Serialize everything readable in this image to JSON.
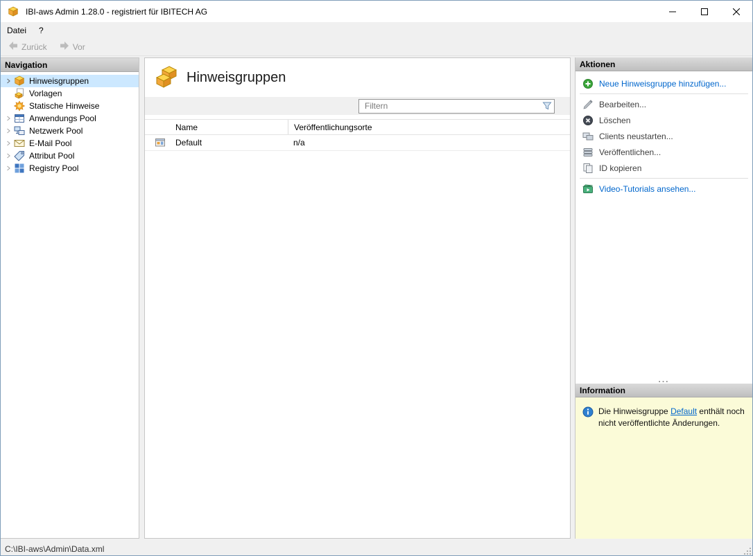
{
  "window": {
    "title": "IBI-aws Admin 1.28.0 - registriert für IBITECH AG"
  },
  "menu": {
    "file": "Datei",
    "help": "?"
  },
  "toolbar": {
    "back": "Zurück",
    "forward": "Vor"
  },
  "navigation": {
    "header": "Navigation",
    "items": [
      {
        "label": "Hinweisgruppen",
        "icon": "hint-group-icon",
        "expandable": true,
        "selected": true
      },
      {
        "label": "Vorlagen",
        "icon": "template-icon",
        "expandable": false,
        "selected": false
      },
      {
        "label": "Statische Hinweise",
        "icon": "static-hint-icon",
        "expandable": false,
        "selected": false
      },
      {
        "label": "Anwendungs Pool",
        "icon": "application-pool-icon",
        "expandable": true,
        "selected": false
      },
      {
        "label": "Netzwerk Pool",
        "icon": "network-pool-icon",
        "expandable": true,
        "selected": false
      },
      {
        "label": "E-Mail Pool",
        "icon": "email-pool-icon",
        "expandable": true,
        "selected": false
      },
      {
        "label": "Attribut Pool",
        "icon": "attribute-pool-icon",
        "expandable": true,
        "selected": false
      },
      {
        "label": "Registry Pool",
        "icon": "registry-pool-icon",
        "expandable": true,
        "selected": false
      }
    ]
  },
  "main": {
    "title": "Hinweisgruppen",
    "filter_placeholder": "Filtern",
    "table": {
      "columns": [
        "Name",
        "Veröffentlichungsorte"
      ],
      "rows": [
        {
          "name": "Default",
          "publish_locations": "n/a"
        }
      ]
    }
  },
  "actions": {
    "header": "Aktionen",
    "items": [
      {
        "label": "Neue Hinweisgruppe hinzufügen...",
        "type": "link",
        "icon": "add-icon"
      },
      {
        "label": "Bearbeiten...",
        "type": "normal",
        "icon": "edit-icon"
      },
      {
        "label": "Löschen",
        "type": "normal",
        "icon": "delete-icon"
      },
      {
        "label": "Clients neustarten...",
        "type": "normal",
        "icon": "restart-clients-icon"
      },
      {
        "label": "Veröffentlichen...",
        "type": "normal",
        "icon": "publish-icon"
      },
      {
        "label": "ID kopieren",
        "type": "normal",
        "icon": "copy-id-icon"
      },
      {
        "label": "Video-Tutorials ansehen...",
        "type": "link",
        "icon": "video-icon"
      }
    ],
    "more_indicator": "..."
  },
  "information": {
    "header": "Information",
    "text_before": "Die Hinweisgruppe ",
    "link": "Default",
    "text_after": " enthält noch nicht veröffentlichte Änderungen."
  },
  "statusbar": {
    "path": "C:\\IBI-aws\\Admin\\Data.xml"
  },
  "icons": {
    "app-icon": "stacked-orange-boxes",
    "filter-icon": "funnel",
    "add-icon": "green-plus-circle",
    "edit-icon": "pencil",
    "delete-icon": "dark-circle-x",
    "restart-clients-icon": "two-monitors",
    "publish-icon": "layer-stack",
    "copy-id-icon": "copy-pages",
    "video-icon": "clapperboard",
    "info-icon": "blue-info-circle",
    "chevron-right-icon": "collapsed-tree-arrow"
  },
  "colors": {
    "link": "#0066cc",
    "selection": "#cce8ff",
    "info_background": "#fbfbd8",
    "header_bar": "#c9c9c9"
  }
}
